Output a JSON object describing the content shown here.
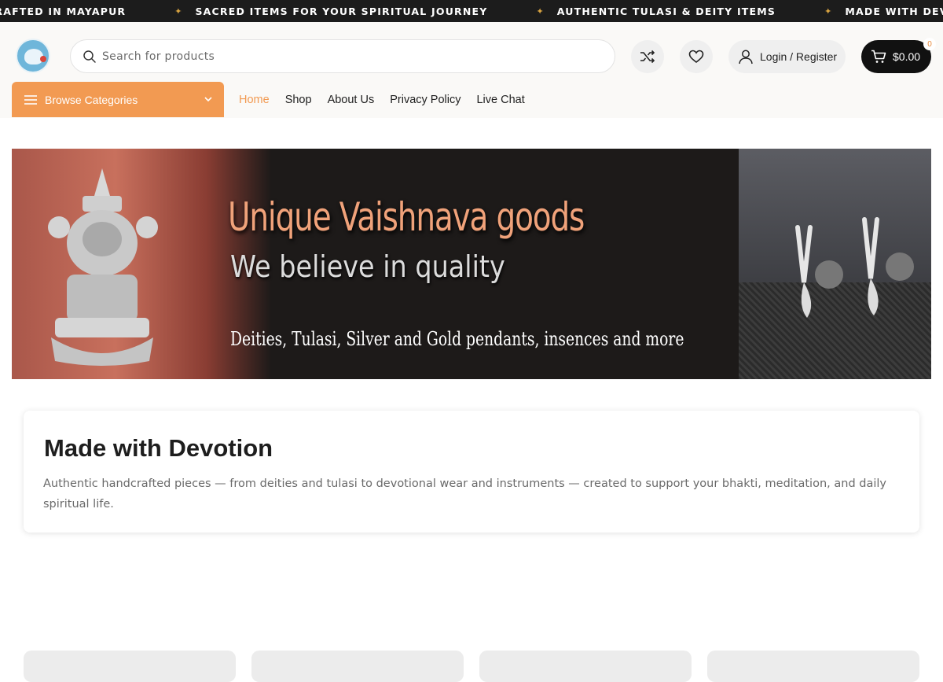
{
  "ticker": {
    "items": [
      "CRAFTED IN MAYAPUR",
      "SACRED ITEMS FOR YOUR SPIRITUAL JOURNEY",
      "AUTHENTIC TULASI & DEITY ITEMS",
      "MADE WITH DEVOTION"
    ],
    "separator": "✦"
  },
  "header": {
    "search": {
      "placeholder": "Search for products"
    },
    "login_label": "Login / Register",
    "cart_total": "$0.00",
    "cart_count": "0"
  },
  "nav": {
    "browse_label": "Browse Categories",
    "items": [
      "Home",
      "Shop",
      "About Us",
      "Privacy Policy",
      "Live Chat"
    ],
    "active": "Home"
  },
  "banner": {
    "title": "Unique Vaishnava goods",
    "subtitle": "We believe in quality",
    "tagline": "Deities, Tulasi, Silver and Gold pendants, insences and more"
  },
  "intro": {
    "title": "Made with Devotion",
    "text": "Authentic handcrafted pieces — from deities and tulasi to devotional wear and instruments — created to support your bhakti, meditation, and daily spiritual life."
  },
  "colors": {
    "accent": "#f29a52",
    "ticker_bg": "#1c1c1c",
    "cart_bg": "#111111"
  }
}
